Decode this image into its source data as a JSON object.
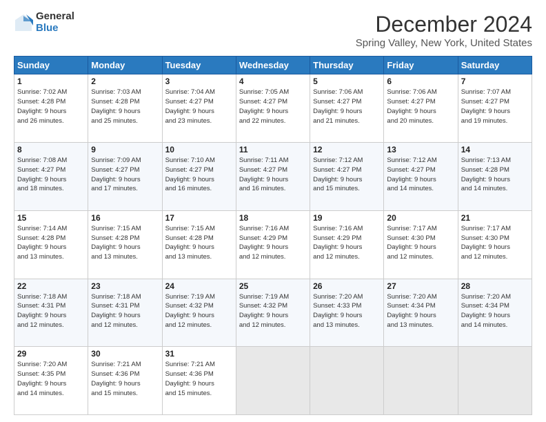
{
  "header": {
    "logo_general": "General",
    "logo_blue": "Blue",
    "title": "December 2024",
    "subtitle": "Spring Valley, New York, United States"
  },
  "columns": [
    "Sunday",
    "Monday",
    "Tuesday",
    "Wednesday",
    "Thursday",
    "Friday",
    "Saturday"
  ],
  "weeks": [
    [
      {
        "day": "1",
        "info": "Sunrise: 7:02 AM\nSunset: 4:28 PM\nDaylight: 9 hours\nand 26 minutes."
      },
      {
        "day": "2",
        "info": "Sunrise: 7:03 AM\nSunset: 4:28 PM\nDaylight: 9 hours\nand 25 minutes."
      },
      {
        "day": "3",
        "info": "Sunrise: 7:04 AM\nSunset: 4:27 PM\nDaylight: 9 hours\nand 23 minutes."
      },
      {
        "day": "4",
        "info": "Sunrise: 7:05 AM\nSunset: 4:27 PM\nDaylight: 9 hours\nand 22 minutes."
      },
      {
        "day": "5",
        "info": "Sunrise: 7:06 AM\nSunset: 4:27 PM\nDaylight: 9 hours\nand 21 minutes."
      },
      {
        "day": "6",
        "info": "Sunrise: 7:06 AM\nSunset: 4:27 PM\nDaylight: 9 hours\nand 20 minutes."
      },
      {
        "day": "7",
        "info": "Sunrise: 7:07 AM\nSunset: 4:27 PM\nDaylight: 9 hours\nand 19 minutes."
      }
    ],
    [
      {
        "day": "8",
        "info": "Sunrise: 7:08 AM\nSunset: 4:27 PM\nDaylight: 9 hours\nand 18 minutes."
      },
      {
        "day": "9",
        "info": "Sunrise: 7:09 AM\nSunset: 4:27 PM\nDaylight: 9 hours\nand 17 minutes."
      },
      {
        "day": "10",
        "info": "Sunrise: 7:10 AM\nSunset: 4:27 PM\nDaylight: 9 hours\nand 16 minutes."
      },
      {
        "day": "11",
        "info": "Sunrise: 7:11 AM\nSunset: 4:27 PM\nDaylight: 9 hours\nand 16 minutes."
      },
      {
        "day": "12",
        "info": "Sunrise: 7:12 AM\nSunset: 4:27 PM\nDaylight: 9 hours\nand 15 minutes."
      },
      {
        "day": "13",
        "info": "Sunrise: 7:12 AM\nSunset: 4:27 PM\nDaylight: 9 hours\nand 14 minutes."
      },
      {
        "day": "14",
        "info": "Sunrise: 7:13 AM\nSunset: 4:28 PM\nDaylight: 9 hours\nand 14 minutes."
      }
    ],
    [
      {
        "day": "15",
        "info": "Sunrise: 7:14 AM\nSunset: 4:28 PM\nDaylight: 9 hours\nand 13 minutes."
      },
      {
        "day": "16",
        "info": "Sunrise: 7:15 AM\nSunset: 4:28 PM\nDaylight: 9 hours\nand 13 minutes."
      },
      {
        "day": "17",
        "info": "Sunrise: 7:15 AM\nSunset: 4:28 PM\nDaylight: 9 hours\nand 13 minutes."
      },
      {
        "day": "18",
        "info": "Sunrise: 7:16 AM\nSunset: 4:29 PM\nDaylight: 9 hours\nand 12 minutes."
      },
      {
        "day": "19",
        "info": "Sunrise: 7:16 AM\nSunset: 4:29 PM\nDaylight: 9 hours\nand 12 minutes."
      },
      {
        "day": "20",
        "info": "Sunrise: 7:17 AM\nSunset: 4:30 PM\nDaylight: 9 hours\nand 12 minutes."
      },
      {
        "day": "21",
        "info": "Sunrise: 7:17 AM\nSunset: 4:30 PM\nDaylight: 9 hours\nand 12 minutes."
      }
    ],
    [
      {
        "day": "22",
        "info": "Sunrise: 7:18 AM\nSunset: 4:31 PM\nDaylight: 9 hours\nand 12 minutes."
      },
      {
        "day": "23",
        "info": "Sunrise: 7:18 AM\nSunset: 4:31 PM\nDaylight: 9 hours\nand 12 minutes."
      },
      {
        "day": "24",
        "info": "Sunrise: 7:19 AM\nSunset: 4:32 PM\nDaylight: 9 hours\nand 12 minutes."
      },
      {
        "day": "25",
        "info": "Sunrise: 7:19 AM\nSunset: 4:32 PM\nDaylight: 9 hours\nand 12 minutes."
      },
      {
        "day": "26",
        "info": "Sunrise: 7:20 AM\nSunset: 4:33 PM\nDaylight: 9 hours\nand 13 minutes."
      },
      {
        "day": "27",
        "info": "Sunrise: 7:20 AM\nSunset: 4:34 PM\nDaylight: 9 hours\nand 13 minutes."
      },
      {
        "day": "28",
        "info": "Sunrise: 7:20 AM\nSunset: 4:34 PM\nDaylight: 9 hours\nand 14 minutes."
      }
    ],
    [
      {
        "day": "29",
        "info": "Sunrise: 7:20 AM\nSunset: 4:35 PM\nDaylight: 9 hours\nand 14 minutes."
      },
      {
        "day": "30",
        "info": "Sunrise: 7:21 AM\nSunset: 4:36 PM\nDaylight: 9 hours\nand 15 minutes."
      },
      {
        "day": "31",
        "info": "Sunrise: 7:21 AM\nSunset: 4:36 PM\nDaylight: 9 hours\nand 15 minutes."
      },
      null,
      null,
      null,
      null
    ]
  ]
}
